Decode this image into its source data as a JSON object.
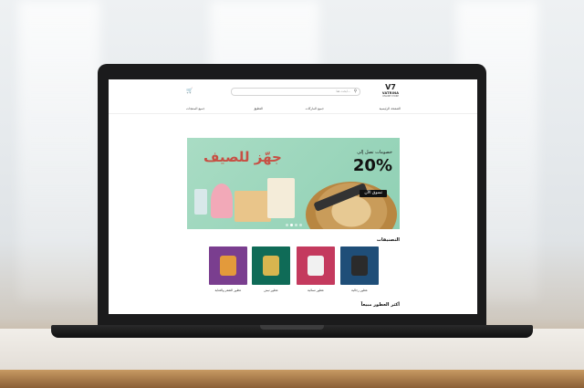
{
  "site": {
    "logo_text": "VATRINA",
    "logo_sub": "ONLINE STORE",
    "search_placeholder": "ابحث هنا...",
    "nav": [
      "الصفحة الرئيسية",
      "جميع الماركات",
      "العطور",
      "جميع المنتجات"
    ],
    "banner": {
      "title": "جهّز للصيف",
      "sub": "خصومات تصل إلى",
      "percent": "20%",
      "button": "تسوق الآن",
      "dots": 4,
      "active_dot": 1
    },
    "categories_title": "التصنيفات",
    "categories": [
      {
        "label": "عطور رجالية",
        "color": "#1f4e78"
      },
      {
        "label": "عطور نسائية",
        "color": "#c43a5e"
      },
      {
        "label": "عطور نيش",
        "color": "#0f6b57"
      },
      {
        "label": "عطور الشعر والعناية",
        "color": "#7a3e8f"
      }
    ],
    "bestsellers_title": "أكثر العطور مبيعاً"
  }
}
